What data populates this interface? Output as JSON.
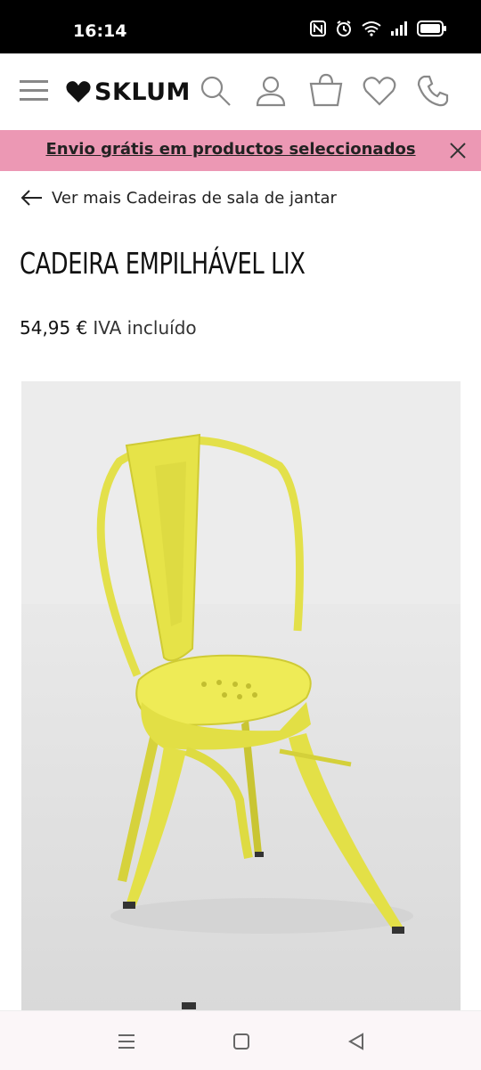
{
  "status_bar": {
    "time": "16:14",
    "icons": [
      "nfc-icon",
      "alarm-icon",
      "wifi-icon",
      "signal-icon",
      "battery-icon"
    ]
  },
  "header": {
    "brand": "SKLUM",
    "icons": [
      "menu-icon",
      "search-icon",
      "user-icon",
      "cart-icon",
      "wishlist-icon",
      "phone-icon"
    ]
  },
  "promo": {
    "text": "Envio grátis em productos seleccionados",
    "background": "#ec98b4"
  },
  "breadcrumb": {
    "back_label": "Ver mais Cadeiras de sala de jantar"
  },
  "product": {
    "title": "CADEIRA EMPILHÁVEL LIX",
    "price": "54,95 €",
    "vat_label": "IVA incluído",
    "image_alt": "Cadeira amarela empilhável",
    "chair_color": "#e8e84a"
  },
  "system_nav": {
    "buttons": [
      "recent-apps-icon",
      "home-icon",
      "back-icon"
    ]
  }
}
